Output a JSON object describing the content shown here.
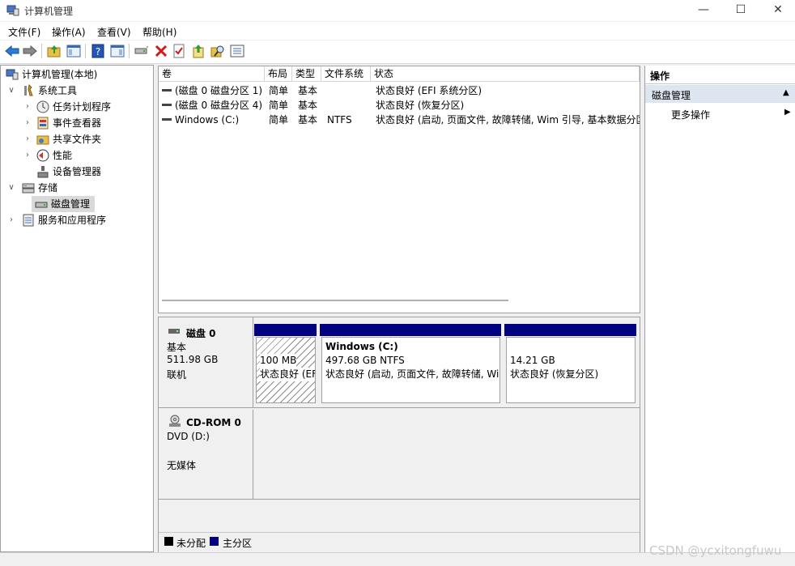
{
  "window": {
    "title": "计算机管理",
    "minimize": "—",
    "maximize": "☐",
    "close": "✕"
  },
  "menu": [
    "文件(F)",
    "操作(A)",
    "查看(V)",
    "帮助(H)"
  ],
  "tree": {
    "root": "计算机管理(本地)",
    "system_tools": "系统工具",
    "task_scheduler": "任务计划程序",
    "event_viewer": "事件查看器",
    "shared_folders": "共享文件夹",
    "performance": "性能",
    "device_manager": "设备管理器",
    "storage": "存储",
    "disk_management": "磁盘管理",
    "services": "服务和应用程序"
  },
  "volume_list": {
    "headers": [
      "卷",
      "布局",
      "类型",
      "文件系统",
      "状态"
    ],
    "rows": [
      [
        "(磁盘 0 磁盘分区 1)",
        "简单",
        "基本",
        "",
        "状态良好 (EFI 系统分区)"
      ],
      [
        "(磁盘 0 磁盘分区 4)",
        "简单",
        "基本",
        "",
        "状态良好 (恢复分区)"
      ],
      [
        "Windows (C:)",
        "简单",
        "基本",
        "NTFS",
        "状态良好 (启动, 页面文件, 故障转储, Wim 引导, 基本数据分区)"
      ]
    ]
  },
  "disk0": {
    "name": "磁盘 0",
    "type": "基本",
    "size": "511.98 GB",
    "state": "联机",
    "partitions": [
      {
        "title": "",
        "size": "100 MB",
        "status": "状态良好 (EFI 系统分区)"
      },
      {
        "title": "Windows  (C:)",
        "size": "497.68 GB NTFS",
        "status": "状态良好 (启动, 页面文件, 故障转储, Wim 引导, 基本数据分区)"
      },
      {
        "title": "",
        "size": "14.21 GB",
        "status": "状态良好 (恢复分区)"
      }
    ]
  },
  "cdrom": {
    "name": "CD-ROM 0",
    "drive": "DVD (D:)",
    "media": "无媒体"
  },
  "legend": {
    "unallocated": "未分配",
    "primary": "主分区"
  },
  "actions": {
    "header": "操作",
    "section": "磁盘管理",
    "more": "更多操作"
  },
  "watermark": "CSDN @ycxitongfuwu",
  "colors": {
    "primary_partition": "#000080",
    "selected_section": "#dde5f0"
  }
}
